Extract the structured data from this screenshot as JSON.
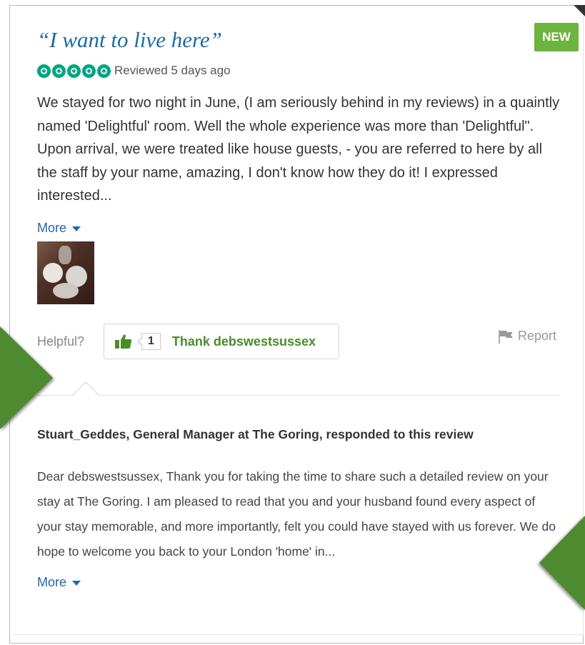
{
  "review": {
    "badge": "NEW",
    "title": "“I want to live here”",
    "rating": 5,
    "reviewed": "Reviewed 5 days ago",
    "text": "We stayed for two night in June, (I am seriously behind in my reviews) in a quaintly named 'Delightful' room. Well the whole experience was more than 'Delightful\". Upon arrival, we were treated like house guests, - you are referred to here by all the staff by your name, amazing, I don't know how they do it! I expressed interested...",
    "more_label": "More",
    "photo_icon": "review-photo"
  },
  "helpful": {
    "label": "Helpful?",
    "count": "1",
    "thank_label": "Thank debswestsussex",
    "report_label": "Report"
  },
  "response": {
    "responder": "Stuart_Geddes, General Manager at The Goring, responded to this review",
    "text": "Dear debswestsussex, Thank you for taking the time to share such a detailed review on your stay at The Goring. I am pleased to read that you and your husband found every aspect of your stay memorable, and more importantly, felt you could have stayed with us forever. We do hope to welcome you back to your London 'home' in...",
    "more_label": "More"
  },
  "colors": {
    "accent_green": "#6cb33f",
    "rating_green": "#00a680",
    "link_blue": "#2267a9",
    "title_blue": "#1b6aa5",
    "arrow_green": "#4e8a2f"
  }
}
